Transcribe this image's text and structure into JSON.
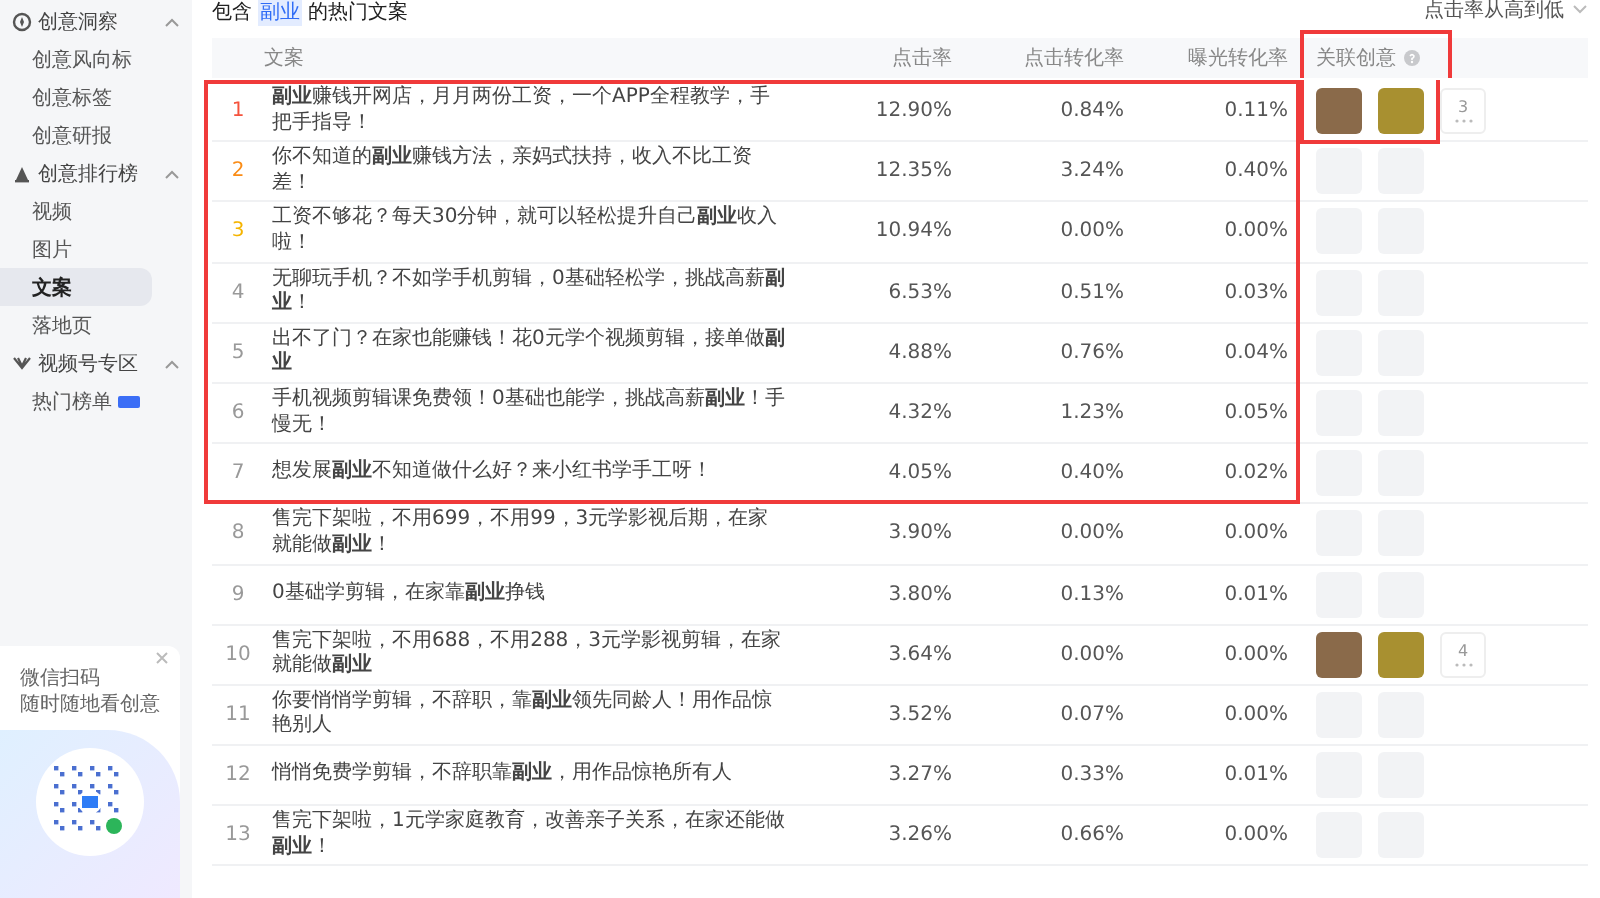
{
  "sidebar": {
    "groups": [
      {
        "label": "创意洞察",
        "expanded": true,
        "items": [
          {
            "label": "创意风向标",
            "selected": false
          },
          {
            "label": "创意标签",
            "selected": false
          },
          {
            "label": "创意研报",
            "selected": false
          }
        ]
      },
      {
        "label": "创意排行榜",
        "expanded": true,
        "items": [
          {
            "label": "视频",
            "selected": false
          },
          {
            "label": "图片",
            "selected": false
          },
          {
            "label": "文案",
            "selected": true
          },
          {
            "label": "落地页",
            "selected": false
          }
        ]
      },
      {
        "label": "视频号专区",
        "expanded": true,
        "items": [
          {
            "label": "热门榜单",
            "selected": false,
            "badge": true
          }
        ]
      }
    ],
    "qr_card": {
      "line_1": "微信扫码",
      "line_2": "随时随地看创意"
    }
  },
  "title": {
    "prefix": "包含",
    "keyword": "副业",
    "suffix": "的热门文案"
  },
  "sort": {
    "label": "点击率从高到低"
  },
  "table": {
    "columns": [
      {
        "label": "文案",
        "highlighted": false
      },
      {
        "label": "点击率",
        "highlighted": false
      },
      {
        "label": "点击转化率",
        "highlighted": false
      },
      {
        "label": "曝光转化率",
        "highlighted": false
      },
      {
        "label": "关联创意",
        "highlighted": true,
        "help": true
      }
    ],
    "rows": [
      {
        "rank": "1",
        "text": "**副业**赚钱开网店，月月两份工资，一个APP全程教学，手把手指导！",
        "ctr": "12.90%",
        "cvr": "0.84%",
        "exposure": "0.11%",
        "highlighted": true,
        "related": {
          "kind": "thumbs",
          "more": "3",
          "highlighted": true
        }
      },
      {
        "rank": "2",
        "text": "你不知道的**副业**赚钱方法，亲妈式扶持，收入不比工资差！",
        "ctr": "12.35%",
        "cvr": "3.24%",
        "exposure": "0.40%",
        "highlighted": true,
        "related": {
          "kind": "placeholder",
          "highlighted": false
        }
      },
      {
        "rank": "3",
        "text": "工资不够花？每天30分钟，就可以轻松提升自己**副业**收入啦！",
        "ctr": "10.94%",
        "cvr": "0.00%",
        "exposure": "0.00%",
        "highlighted": true,
        "related": {
          "kind": "placeholder",
          "highlighted": false
        }
      },
      {
        "rank": "4",
        "text": "无聊玩手机？不如学手机剪辑，0基础轻松学，挑战高薪**副业**！",
        "ctr": "6.53%",
        "cvr": "0.51%",
        "exposure": "0.03%",
        "highlighted": true,
        "related": {
          "kind": "placeholder",
          "highlighted": false
        }
      },
      {
        "rank": "5",
        "text": "出不了门？在家也能赚钱！花0元学个视频剪辑，接单做**副业**",
        "ctr": "4.88%",
        "cvr": "0.76%",
        "exposure": "0.04%",
        "highlighted": true,
        "related": {
          "kind": "placeholder",
          "highlighted": false
        }
      },
      {
        "rank": "6",
        "text": "手机视频剪辑课免费领！0基础也能学，挑战高薪**副业**！手慢无！",
        "ctr": "4.32%",
        "cvr": "1.23%",
        "exposure": "0.05%",
        "highlighted": true,
        "related": {
          "kind": "placeholder",
          "highlighted": false
        }
      },
      {
        "rank": "7",
        "text": "想发展**副业**不知道做什么好？来小红书学手工呀！",
        "ctr": "4.05%",
        "cvr": "0.40%",
        "exposure": "0.02%",
        "highlighted": true,
        "related": {
          "kind": "placeholder",
          "highlighted": false
        }
      },
      {
        "rank": "8",
        "text": "售完下架啦，不用699，不用99，3元学影视后期，在家就能做**副业**！",
        "ctr": "3.90%",
        "cvr": "0.00%",
        "exposure": "0.00%",
        "highlighted": false,
        "related": {
          "kind": "placeholder",
          "highlighted": false
        }
      },
      {
        "rank": "9",
        "text": "0基础学剪辑，在家靠**副业**挣钱",
        "ctr": "3.80%",
        "cvr": "0.13%",
        "exposure": "0.01%",
        "highlighted": false,
        "related": {
          "kind": "placeholder",
          "highlighted": false
        }
      },
      {
        "rank": "10",
        "text": "售完下架啦，不用688，不用288，3元学影视剪辑，在家就能做**副业**",
        "ctr": "3.64%",
        "cvr": "0.00%",
        "exposure": "0.00%",
        "highlighted": false,
        "related": {
          "kind": "thumbs",
          "more": "4",
          "highlighted": false
        }
      },
      {
        "rank": "11",
        "text": "你要悄悄学剪辑，不辞职，靠**副业**领先同龄人！用作品惊艳别人",
        "ctr": "3.52%",
        "cvr": "0.07%",
        "exposure": "0.00%",
        "highlighted": false,
        "related": {
          "kind": "placeholder",
          "highlighted": false
        }
      },
      {
        "rank": "12",
        "text": "悄悄免费学剪辑，不辞职靠**副业**，用作品惊艳所有人",
        "ctr": "3.27%",
        "cvr": "0.33%",
        "exposure": "0.01%",
        "highlighted": false,
        "related": {
          "kind": "placeholder",
          "highlighted": false
        }
      },
      {
        "rank": "13",
        "text": "售完下架啦，1元学家庭教育，改善亲子关系，在家还能做**副业**！",
        "ctr": "3.26%",
        "cvr": "0.66%",
        "exposure": "0.00%",
        "highlighted": false,
        "related": {
          "kind": "placeholder",
          "highlighted": false
        }
      }
    ]
  }
}
